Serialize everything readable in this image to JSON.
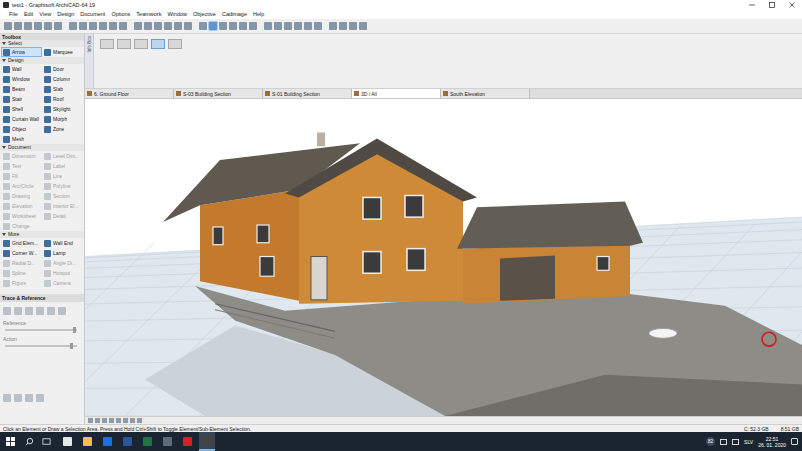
{
  "window": {
    "title": "test1 - Graphisoft ArchiCAD-64 19"
  },
  "menu": [
    "File",
    "Edit",
    "View",
    "Design",
    "Document",
    "Options",
    "Teamwork",
    "Window",
    "Objective",
    "Cadimage",
    "Help"
  ],
  "toolbox": {
    "title": "Toolbox",
    "sections": [
      {
        "title": "Select",
        "expanded": true,
        "items": [
          {
            "label": "Arrow",
            "disabled": false,
            "selected": true
          },
          {
            "label": "Marquee",
            "disabled": false,
            "selected": false
          }
        ]
      },
      {
        "title": "Design",
        "expanded": true,
        "items": [
          {
            "label": "Wall",
            "disabled": false,
            "selected": false
          },
          {
            "label": "Door",
            "disabled": false,
            "selected": false
          },
          {
            "label": "Window",
            "disabled": false,
            "selected": false
          },
          {
            "label": "Column",
            "disabled": false,
            "selected": false
          },
          {
            "label": "Beam",
            "disabled": false,
            "selected": false
          },
          {
            "label": "Slab",
            "disabled": false,
            "selected": false
          },
          {
            "label": "Stair",
            "disabled": false,
            "selected": false
          },
          {
            "label": "Roof",
            "disabled": false,
            "selected": false
          },
          {
            "label": "Shell",
            "disabled": false,
            "selected": false
          },
          {
            "label": "Skylight",
            "disabled": false,
            "selected": false
          },
          {
            "label": "Curtain Wall",
            "disabled": false,
            "selected": false
          },
          {
            "label": "Morph",
            "disabled": false,
            "selected": false
          },
          {
            "label": "Object",
            "disabled": false,
            "selected": false
          },
          {
            "label": "Zone",
            "disabled": false,
            "selected": false
          },
          {
            "label": "Mesh",
            "disabled": false,
            "selected": false
          }
        ]
      },
      {
        "title": "Document",
        "expanded": true,
        "items": [
          {
            "label": "Dimension",
            "disabled": true,
            "selected": false
          },
          {
            "label": "Level Dim...",
            "disabled": true,
            "selected": false
          },
          {
            "label": "Text",
            "disabled": true,
            "selected": false
          },
          {
            "label": "Label",
            "disabled": true,
            "selected": false
          },
          {
            "label": "Fill",
            "disabled": true,
            "selected": false
          },
          {
            "label": "Line",
            "disabled": true,
            "selected": false
          },
          {
            "label": "Arc/Circle",
            "disabled": true,
            "selected": false
          },
          {
            "label": "Polyline",
            "disabled": true,
            "selected": false
          },
          {
            "label": "Drawing",
            "disabled": true,
            "selected": false
          },
          {
            "label": "Section",
            "disabled": true,
            "selected": false
          },
          {
            "label": "Elevation",
            "disabled": true,
            "selected": false
          },
          {
            "label": "Interior El...",
            "disabled": true,
            "selected": false
          },
          {
            "label": "Worksheet",
            "disabled": true,
            "selected": false
          },
          {
            "label": "Detail",
            "disabled": true,
            "selected": false
          },
          {
            "label": "Change",
            "disabled": true,
            "selected": false
          }
        ]
      },
      {
        "title": "More",
        "expanded": true,
        "items": [
          {
            "label": "Grid Elem...",
            "disabled": false,
            "selected": false
          },
          {
            "label": "Wall End",
            "disabled": false,
            "selected": false
          },
          {
            "label": "Corner W...",
            "disabled": false,
            "selected": false
          },
          {
            "label": "Lamp",
            "disabled": false,
            "selected": false
          },
          {
            "label": "Radial D...",
            "disabled": true,
            "selected": false
          },
          {
            "label": "Angle Di...",
            "disabled": true,
            "selected": false
          },
          {
            "label": "Spline",
            "disabled": true,
            "selected": false
          },
          {
            "label": "Hotspot",
            "disabled": true,
            "selected": false
          },
          {
            "label": "Figure",
            "disabled": true,
            "selected": false
          },
          {
            "label": "Camera",
            "disabled": true,
            "selected": false
          }
        ]
      }
    ]
  },
  "trace_panel": {
    "title": "Trace & Reference",
    "sliders": [
      {
        "label": "Reference",
        "level": 0.97
      },
      {
        "label": "Action",
        "level": 0.93
      }
    ]
  },
  "infobox": {
    "label": "Info Box"
  },
  "tabs": [
    {
      "label": "6. Ground Floor",
      "selected": false
    },
    {
      "label": "S-03 Building Section",
      "selected": false
    },
    {
      "label": "S-01 Building Section",
      "selected": false
    },
    {
      "label": "3D / All",
      "selected": true
    },
    {
      "label": "South Elevation",
      "selected": false
    }
  ],
  "status_bar": {
    "message": "Click an Element or Draw a Selection Area. Press and Hold Ctrl+Shift to Toggle Element/Sub-Element Selection.",
    "disk": "C: 52.3 GB",
    "memory": "8.51 GB"
  },
  "taskbar": {
    "tray_badge": "82",
    "language": "SLV",
    "time": "22:51",
    "date": "26. 01. 2020"
  }
}
